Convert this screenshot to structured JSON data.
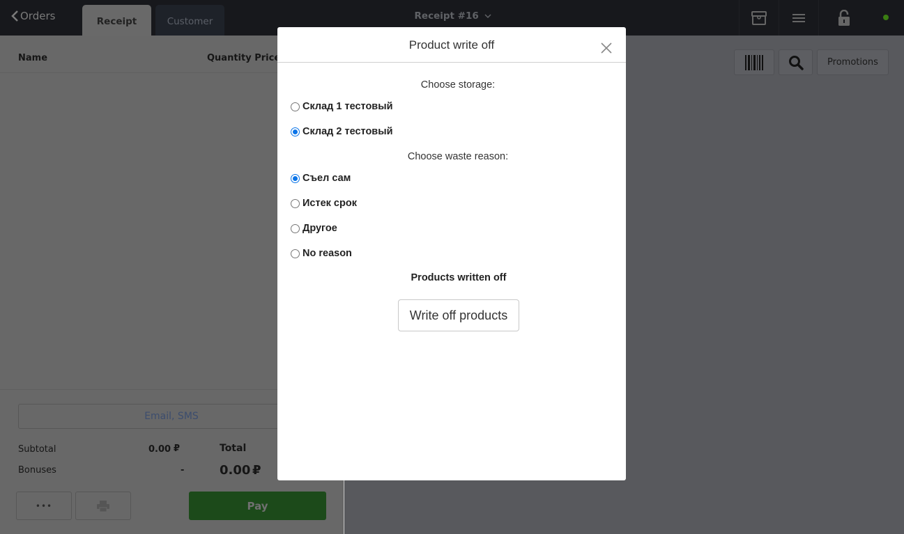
{
  "topbar": {
    "back_label": "Orders",
    "tabs": [
      {
        "label": "Receipt",
        "active": true
      },
      {
        "label": "Customer",
        "active": false
      }
    ],
    "title": "Receipt #16",
    "icons": [
      "archive-box-icon",
      "menu-icon",
      "unlock-icon"
    ],
    "status_color": "#3a7d12"
  },
  "receipt": {
    "columns": {
      "name": "Name",
      "quantity_price": "Quantity Price"
    },
    "contact_placeholder": "Email, SMS",
    "subtotal_label": "Subtotal",
    "subtotal_value": "0.00",
    "currency": "₽",
    "bonuses_label": "Bonuses",
    "bonuses_value": "-",
    "total_label": "Total",
    "total_value": "0.00",
    "more_label": "•••",
    "pay_label": "Pay"
  },
  "right_toolbar": {
    "promotions_label": "Promotions"
  },
  "modal": {
    "title": "Product write off",
    "storage_label": "Choose storage:",
    "storages": [
      {
        "label": "Склад 1 тестовый",
        "checked": false
      },
      {
        "label": "Склад 2 тестовый",
        "checked": true
      }
    ],
    "reason_label": "Choose waste reason:",
    "reasons": [
      {
        "label": "Съел сам",
        "checked": true
      },
      {
        "label": "Истек срок",
        "checked": false
      },
      {
        "label": "Другое",
        "checked": false
      },
      {
        "label": "No reason",
        "checked": false
      }
    ],
    "written_off_label": "Products written off",
    "write_off_button": "Write off products"
  }
}
